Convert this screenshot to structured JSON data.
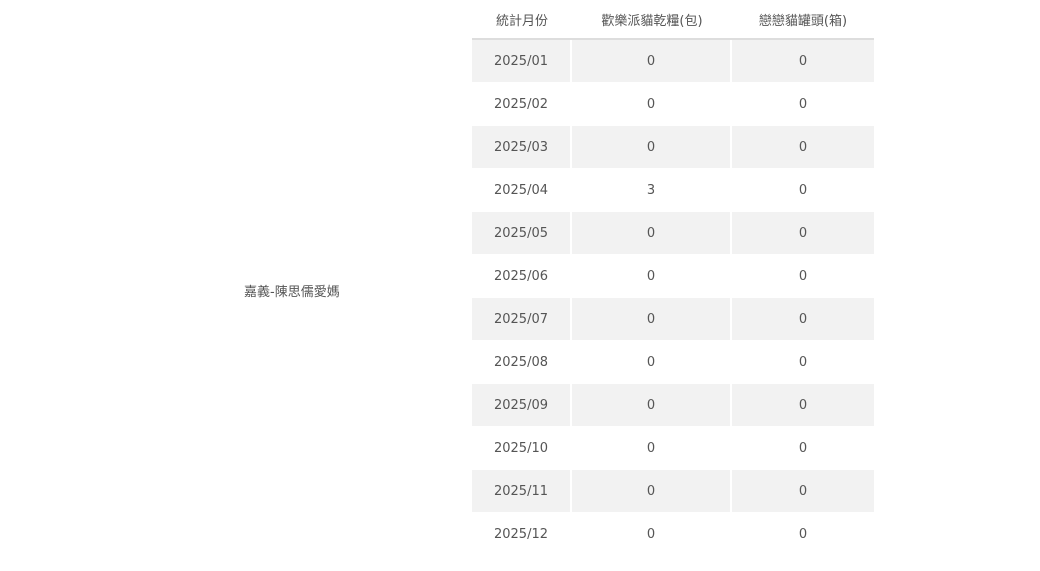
{
  "owner": {
    "name": "嘉義-陳思儒愛媽"
  },
  "table": {
    "headers": [
      "統計月份",
      "歡樂派貓乾糧(包)",
      "戀戀貓罐頭(箱)"
    ],
    "rows": [
      [
        "2025/01",
        "0",
        "0"
      ],
      [
        "2025/02",
        "0",
        "0"
      ],
      [
        "2025/03",
        "0",
        "0"
      ],
      [
        "2025/04",
        "3",
        "0"
      ],
      [
        "2025/05",
        "0",
        "0"
      ],
      [
        "2025/06",
        "0",
        "0"
      ],
      [
        "2025/07",
        "0",
        "0"
      ],
      [
        "2025/08",
        "0",
        "0"
      ],
      [
        "2025/09",
        "0",
        "0"
      ],
      [
        "2025/10",
        "0",
        "0"
      ],
      [
        "2025/11",
        "0",
        "0"
      ],
      [
        "2025/12",
        "0",
        "0"
      ]
    ]
  }
}
